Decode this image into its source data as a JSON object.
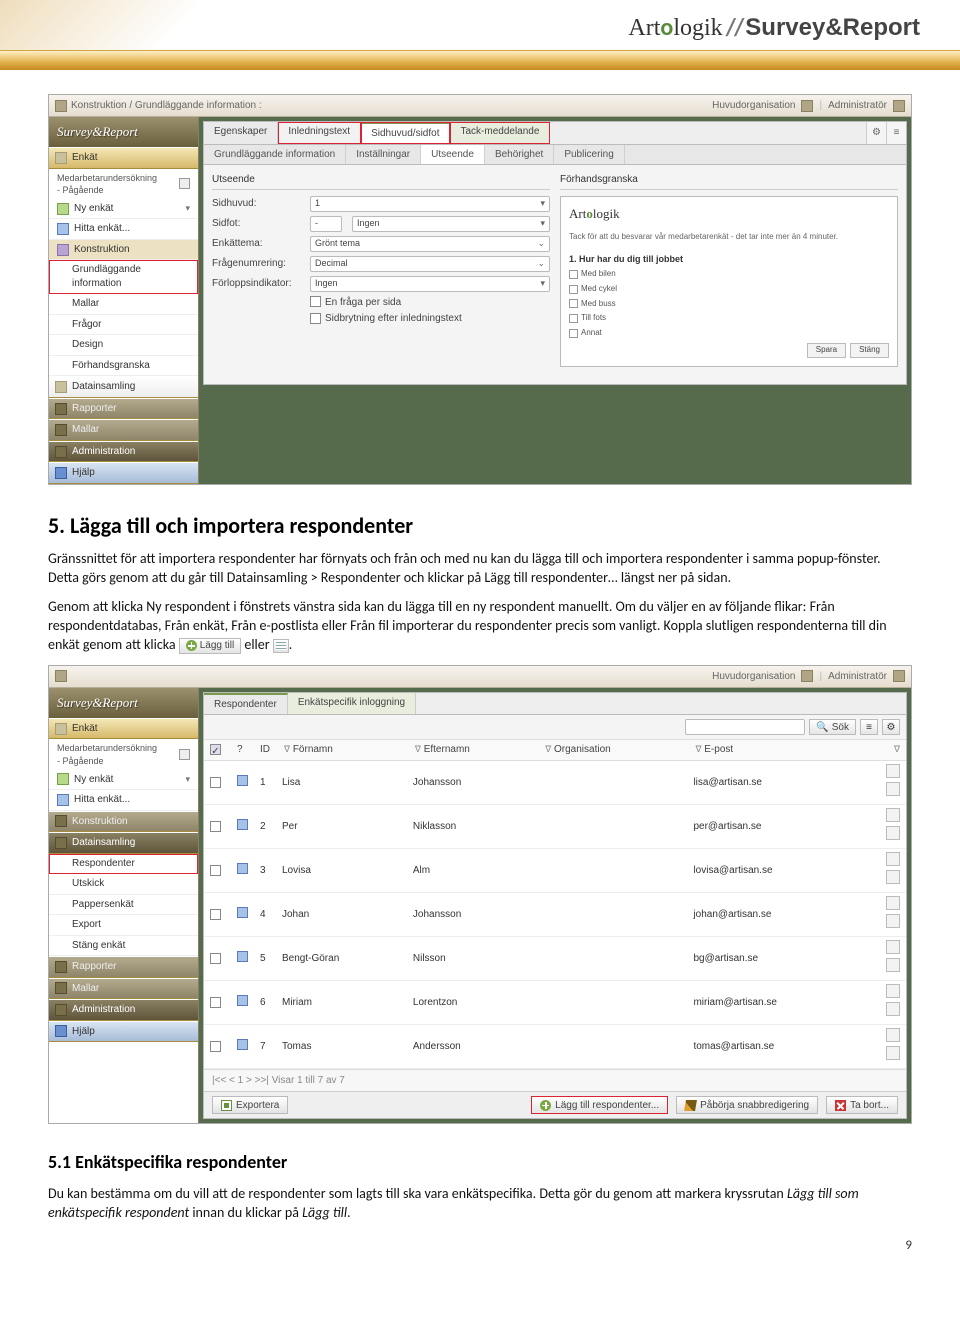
{
  "page_number": "9",
  "header_brand": {
    "prefix": "Art",
    "o": "o",
    "suffix1": "logik",
    "slashes": "//",
    "product": "Survey&Report"
  },
  "section5": {
    "heading": "5. Lägga till och importera respondenter",
    "p1": "Gränssnittet för att importera respondenter har förnyats och från och med nu kan du lägga till och importera respondenter i samma popup-fönster. Detta görs genom att du går till Datainsamling > Respondenter och klickar på Lägg till respondenter… längst ner på sidan.",
    "p2a": "Genom att klicka Ny respondent i fönstrets vänstra sida kan du lägga till en ny respondent manuellt. Om du väljer en av följande flikar: Från respondentdatabas, Från enkät, Från e-postlista eller Från fil importerar du respondenter precis som vanligt. Koppla slutligen respondenterna till din enkät genom att klicka ",
    "p2b": " eller ",
    "p2c": ".",
    "inline_btn_label": "Lägg till",
    "sub51_heading": "5.1  Enkätspecifika respondenter",
    "sub51_p1_a": "Du kan bestämma om du vill att de respondenter som lagts till ska vara enkätspecifika. Detta gör du genom att markera kryssrutan ",
    "sub51_p1_italic1": "Lägg till som enkätspecifik respondent",
    "sub51_p1_b": " innan du klickar på ",
    "sub51_p1_italic2": "Lägg till",
    "sub51_p1_c": "."
  },
  "app_common": {
    "logo": "Survey&Report",
    "breadcrumb_top": "Konstruktion / Grundläggande information :",
    "org_label": "Huvudorganisation",
    "user_label": "Administratör",
    "survey_line1": "Medarbetarundersökning",
    "survey_line2": "- Pågående"
  },
  "sidebar1": {
    "enkat": "Enkät",
    "ny": "Ny enkät",
    "hitta": "Hitta enkät...",
    "konstruktion": "Konstruktion",
    "grund": "Grundläggande information",
    "mallar_item": "Mallar",
    "fragor": "Frågor",
    "design": "Design",
    "forhand": "Förhandsgranska",
    "datainsamling": "Datainsamling",
    "rapporter": "Rapporter",
    "mallar": "Mallar",
    "admin": "Administration",
    "hjalp": "Hjälp"
  },
  "shot1": {
    "tabs1": [
      "Egenskaper",
      "Inledningstext",
      "Sidhuvud/sidfot",
      "Tack-meddelande"
    ],
    "tabs2": [
      "Grundläggande information",
      "Inställningar",
      "Utseende",
      "Behörighet",
      "Publicering"
    ],
    "left": {
      "group": "Utseende",
      "sidhuvud": "Sidhuvud:",
      "sidhuvud_val": "1",
      "sidfot": "Sidfot:",
      "sidfot_val1": "-",
      "sidfot_val2": "Ingen",
      "tema": "Enkättema:",
      "tema_val": "Grönt tema",
      "num": "Frågenumrering:",
      "num_val": "Decimal",
      "prog": "Förloppsindikator:",
      "prog_val": "Ingen",
      "chk1": "En fråga per sida",
      "chk2": "Sidbrytning efter inledningstext"
    },
    "right": {
      "group": "Förhandsgranska",
      "logo": "Artologik",
      "intro": "Tack för att du besvarar vår medarbetarenkät - det tar inte mer än 4 minuter.",
      "q1": "1. Hur har du dig till jobbet",
      "opts": [
        "Med bilen",
        "Med cykel",
        "Med buss",
        "Till fots",
        "Annat"
      ],
      "btn_save": "Spara",
      "btn_close": "Stäng"
    }
  },
  "sidebar2": {
    "enkat": "Enkät",
    "ny": "Ny enkät",
    "hitta": "Hitta enkät...",
    "konstruktion": "Konstruktion",
    "datainsamling": "Datainsamling",
    "respondenter": "Respondenter",
    "utskick": "Utskick",
    "pappersenkat": "Pappersenkät",
    "export": "Export",
    "stang": "Stäng enkät",
    "rapporter": "Rapporter",
    "mallar": "Mallar",
    "admin": "Administration",
    "hjalp": "Hjälp"
  },
  "shot2": {
    "tabs1": [
      "Respondenter",
      "Enkätspecifik inloggning"
    ],
    "search_btn": "Sök",
    "cols": {
      "id": "ID",
      "fn": "Förnamn",
      "ln": "Efternamn",
      "org": "Organisation",
      "email": "E-post"
    },
    "rows": [
      {
        "idx": "1",
        "fn": "Lisa",
        "ln": "Johansson",
        "org": "",
        "email": "lisa@artisan.se"
      },
      {
        "idx": "2",
        "fn": "Per",
        "ln": "Niklasson",
        "org": "",
        "email": "per@artisan.se"
      },
      {
        "idx": "3",
        "fn": "Lovisa",
        "ln": "Alm",
        "org": "",
        "email": "lovisa@artisan.se"
      },
      {
        "idx": "4",
        "fn": "Johan",
        "ln": "Johansson",
        "org": "",
        "email": "johan@artisan.se"
      },
      {
        "idx": "5",
        "fn": "Bengt-Göran",
        "ln": "Nilsson",
        "org": "",
        "email": "bg@artisan.se"
      },
      {
        "idx": "6",
        "fn": "Miriam",
        "ln": "Lorentzon",
        "org": "",
        "email": "miriam@artisan.se"
      },
      {
        "idx": "7",
        "fn": "Tomas",
        "ln": "Andersson",
        "org": "",
        "email": "tomas@artisan.se"
      }
    ],
    "pager": "|<< < 1 > >>|  Visar 1 till 7 av 7",
    "footer": {
      "export": "Exportera",
      "add": "Lägg till respondenter...",
      "quick": "Påbörja snabbredigering",
      "del": "Ta bort..."
    }
  }
}
